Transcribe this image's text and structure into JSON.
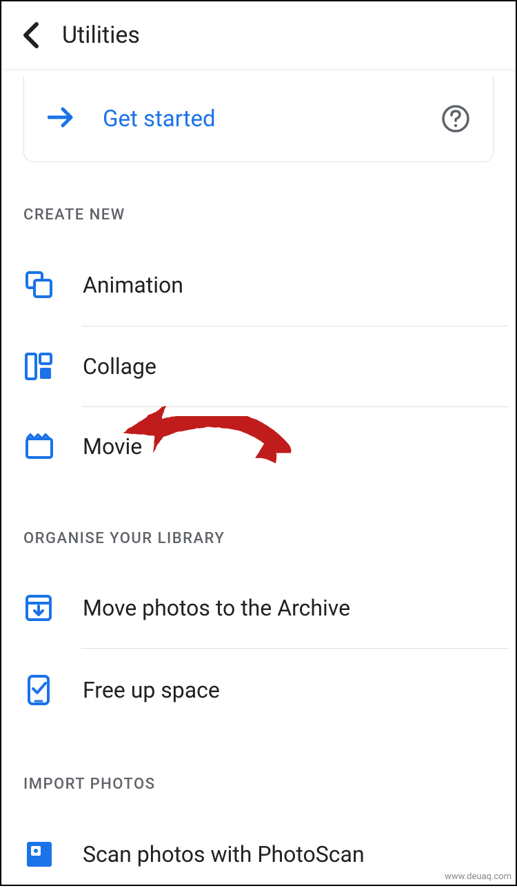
{
  "header": {
    "title": "Utilities"
  },
  "card": {
    "get_started": "Get started"
  },
  "sections": {
    "create_new": {
      "header": "CREATE NEW",
      "animation": "Animation",
      "collage": "Collage",
      "movie": "Movie"
    },
    "organise": {
      "header": "ORGANISE YOUR LIBRARY",
      "archive": "Move photos to the Archive",
      "free_up": "Free up space"
    },
    "import": {
      "header": "IMPORT PHOTOS",
      "photoscan": "Scan photos with PhotoScan"
    }
  },
  "colors": {
    "accent": "#1a73e8",
    "text": "#202124",
    "muted": "#5f6368",
    "annotation": "#c01a1a"
  },
  "watermark": "www.deuaq.com"
}
